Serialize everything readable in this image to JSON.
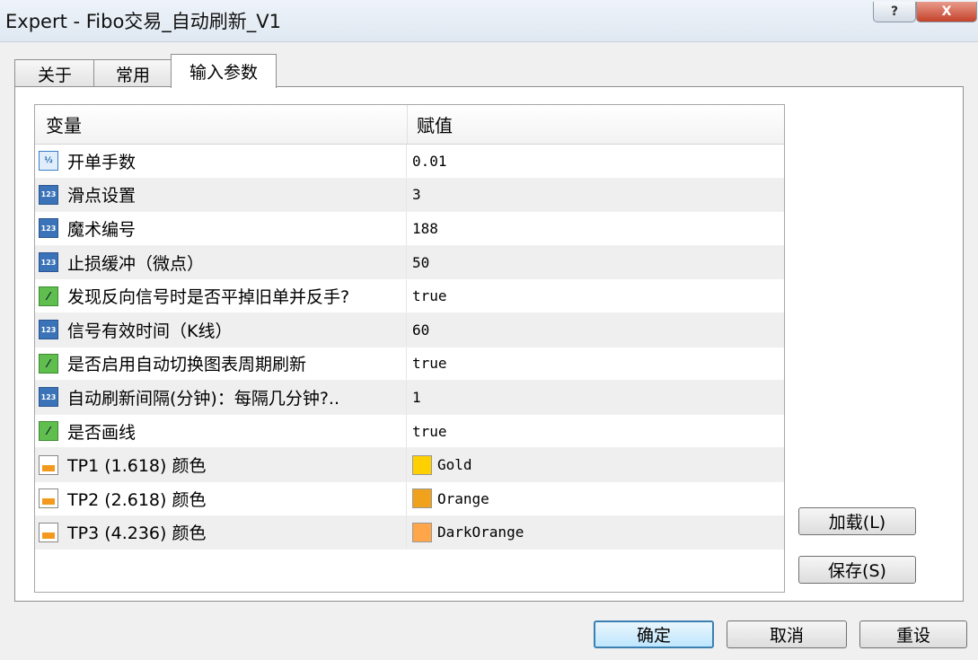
{
  "window": {
    "title": "Expert - Fibo交易_自动刷新_V1",
    "help_label": "?",
    "close_label": "X"
  },
  "tabs": [
    "关于",
    "常用",
    "输入参数"
  ],
  "table": {
    "headers": [
      "变量",
      "赋值"
    ],
    "rows": [
      {
        "name": "开单手数",
        "value": "0.01",
        "icon": "fraction-icon"
      },
      {
        "name": "滑点设置",
        "value": "3",
        "icon": "integer-icon"
      },
      {
        "name": "魔术编号",
        "value": "188",
        "icon": "integer-icon"
      },
      {
        "name": "止损缓冲（微点）",
        "value": "50",
        "icon": "integer-icon"
      },
      {
        "name": "发现反向信号时是否平掉旧单并反手?",
        "value": "true",
        "icon": "bool-icon"
      },
      {
        "name": "信号有效时间（K线）",
        "value": "60",
        "icon": "integer-icon"
      },
      {
        "name": "是否启用自动切换图表周期刷新",
        "value": "true",
        "icon": "bool-icon"
      },
      {
        "name": "自动刷新间隔(分钟)：每隔几分钟?..",
        "value": "1",
        "icon": "integer-icon"
      },
      {
        "name": "是否画线",
        "value": "true",
        "icon": "bool-icon"
      },
      {
        "name": "TP1 (1.618) 颜色",
        "value": "Gold",
        "icon": "color-icon",
        "swatch": "#ffd000"
      },
      {
        "name": "TP2 (2.618) 颜色",
        "value": "Orange",
        "icon": "color-icon",
        "swatch": "#f0a21d"
      },
      {
        "name": "TP3 (4.236) 颜色",
        "value": "DarkOrange",
        "icon": "color-icon",
        "swatch": "#ffa54a"
      }
    ]
  },
  "buttons": {
    "load": "加载(L)",
    "save": "保存(S)",
    "ok": "确定",
    "cancel": "取消",
    "reset": "重设"
  }
}
